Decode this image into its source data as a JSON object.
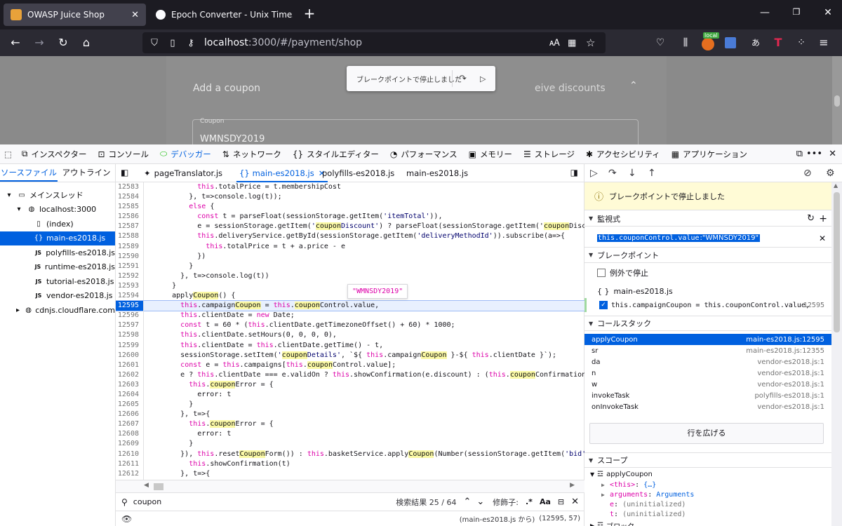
{
  "browser": {
    "tabs": [
      {
        "title": "OWASP Juice Shop",
        "active": true
      },
      {
        "title": "Epoch Converter - Unix Timesta",
        "active": false
      }
    ],
    "url_host": "localhost",
    "url_rest": ":3000/#/payment/shop",
    "local_badge": "local"
  },
  "page": {
    "add_coupon": "Add a coupon",
    "discount_hint": "eive discounts",
    "coupon_label": "Coupon",
    "coupon_value": "WMNSDY2019",
    "paused_popup": "ブレークポイントで停止しました"
  },
  "devtools": {
    "tools": [
      {
        "label": "インスペクター",
        "icon": "inspector-icon"
      },
      {
        "label": "コンソール",
        "icon": "console-icon"
      },
      {
        "label": "デバッガー",
        "icon": "debugger-icon",
        "selected": true
      },
      {
        "label": "ネットワーク",
        "icon": "network-icon"
      },
      {
        "label": "スタイルエディター",
        "icon": "style-editor-icon"
      },
      {
        "label": "パフォーマンス",
        "icon": "performance-icon"
      },
      {
        "label": "メモリー",
        "icon": "memory-icon"
      },
      {
        "label": "ストレージ",
        "icon": "storage-icon"
      },
      {
        "label": "アクセシビリティ",
        "icon": "accessibility-icon"
      },
      {
        "label": "アプリケーション",
        "icon": "application-icon"
      }
    ],
    "left_tabs": [
      "ソースファイル",
      "アウトライン"
    ],
    "tree": [
      {
        "label": "メインスレッド"
      },
      {
        "label": "localhost:3000"
      },
      {
        "label": "(index)"
      },
      {
        "label": "main-es2018.js"
      },
      {
        "label": "polyfills-es2018.js"
      },
      {
        "label": "runtime-es2018.js"
      },
      {
        "label": "tutorial-es2018.js"
      },
      {
        "label": "vendor-es2018.js"
      },
      {
        "label": "cdnjs.cloudflare.com"
      }
    ],
    "source_tabs": [
      "pageTranslator.js",
      "main-es2018.js",
      "polyfills-es2018.js",
      "main-es2018.js"
    ],
    "hover_value": "\"WMNSDY2019\"",
    "search": {
      "query": "coupon",
      "results": "検索結果 25 / 64",
      "modifiers_label": "修飾子:",
      "regex": ".*",
      "case": "Aa"
    },
    "status": {
      "from": "(main-es2018.js から)",
      "pos": "(12595, 57)"
    },
    "right": {
      "paused_banner": "ブレークポイントで停止しました",
      "watch_header": "監視式",
      "watch_expr": "this.couponControl.value",
      "watch_sep": ": ",
      "watch_value": "\"WMNSDY2019\"",
      "bp_header": "ブレークポイント",
      "pause_on_exceptions": "例外で停止",
      "bp_file": "main-es2018.js",
      "bp_code": "this.campaignCoupon = this.couponControl.value,",
      "bp_line": "12595",
      "callstack_header": "コールスタック",
      "frames": [
        {
          "fn": "applyCoupon",
          "loc": "main-es2018.js:12595"
        },
        {
          "fn": "sr",
          "loc": "main-es2018.js:12355"
        },
        {
          "fn": "da",
          "loc": "vendor-es2018.js:1"
        },
        {
          "fn": "n",
          "loc": "vendor-es2018.js:1"
        },
        {
          "fn": "w",
          "loc": "vendor-es2018.js:1"
        },
        {
          "fn": "invokeTask",
          "loc": "polyfills-es2018.js:1"
        },
        {
          "fn": "onInvokeTask",
          "loc": "vendor-es2018.js:1"
        }
      ],
      "expand_rows": "行を広げる",
      "scope_header": "スコープ",
      "scope_fn": "applyCoupon",
      "scope_items": [
        {
          "k": "<this>",
          "v": "{…}"
        },
        {
          "k": "arguments",
          "v": "Arguments"
        },
        {
          "k": "e",
          "v": "(uninitialized)"
        },
        {
          "k": "t",
          "v": "(uninitialized)"
        }
      ],
      "block_label": "ブロック"
    }
  },
  "code_lines": [
    {
      "n": "12583",
      "t": "            this.totalPrice = t.membershipCost"
    },
    {
      "n": "12584",
      "t": "          }, t=>console.log(t));"
    },
    {
      "n": "12585",
      "t": "          else {"
    },
    {
      "n": "12586",
      "t": "            const t = parseFloat(sessionStorage.getItem('itemTotal')),"
    },
    {
      "n": "12587",
      "t": "            e = sessionStorage.getItem('couponDiscount') ? parseFloat(sessionStorage.getItem('couponDiscou"
    },
    {
      "n": "12588",
      "t": "            this.deliveryService.getById(sessionStorage.getItem('deliveryMethodId')).subscribe(a=>{"
    },
    {
      "n": "12589",
      "t": "              this.totalPrice = t + a.price - e"
    },
    {
      "n": "12590",
      "t": "            })"
    },
    {
      "n": "12591",
      "t": "          }"
    },
    {
      "n": "12592",
      "t": "        }, t=>console.log(t))"
    },
    {
      "n": "12593",
      "t": "      }"
    },
    {
      "n": "12594",
      "t": "      applyCoupon() {"
    },
    {
      "n": "12595",
      "t": "        this.campaignCoupon = this.couponControl.value,"
    },
    {
      "n": "12596",
      "t": "        this.clientDate = new Date;"
    },
    {
      "n": "12597",
      "t": "        const t = 60 * (this.clientDate.getTimezoneOffset() + 60) * 1000;"
    },
    {
      "n": "12598",
      "t": "        this.clientDate.setHours(0, 0, 0, 0),"
    },
    {
      "n": "12599",
      "t": "        this.clientDate = this.clientDate.getTime() - t,"
    },
    {
      "n": "12600",
      "t": "        sessionStorage.setItem('couponDetails', `${ this.campaignCoupon }-${ this.clientDate }`);"
    },
    {
      "n": "12601",
      "t": "        const e = this.campaigns[this.couponControl.value];"
    },
    {
      "n": "12602",
      "t": "        e ? this.clientDate === e.validOn ? this.showConfirmation(e.discount) : (this.couponConfirmation ="
    },
    {
      "n": "12603",
      "t": "          this.couponError = {"
    },
    {
      "n": "12604",
      "t": "            error: t"
    },
    {
      "n": "12605",
      "t": "          }"
    },
    {
      "n": "12606",
      "t": "        }, t=>{"
    },
    {
      "n": "12607",
      "t": "          this.couponError = {"
    },
    {
      "n": "12608",
      "t": "            error: t"
    },
    {
      "n": "12609",
      "t": "          }"
    },
    {
      "n": "12610",
      "t": "        }), this.resetCouponForm()) : this.basketService.applyCoupon(Number(sessionStorage.getItem('bid'))"
    },
    {
      "n": "12611",
      "t": "          this.showConfirmation(t)"
    },
    {
      "n": "12612",
      "t": "        }, t=>{"
    },
    {
      "n": "12613",
      "t": ""
    }
  ]
}
